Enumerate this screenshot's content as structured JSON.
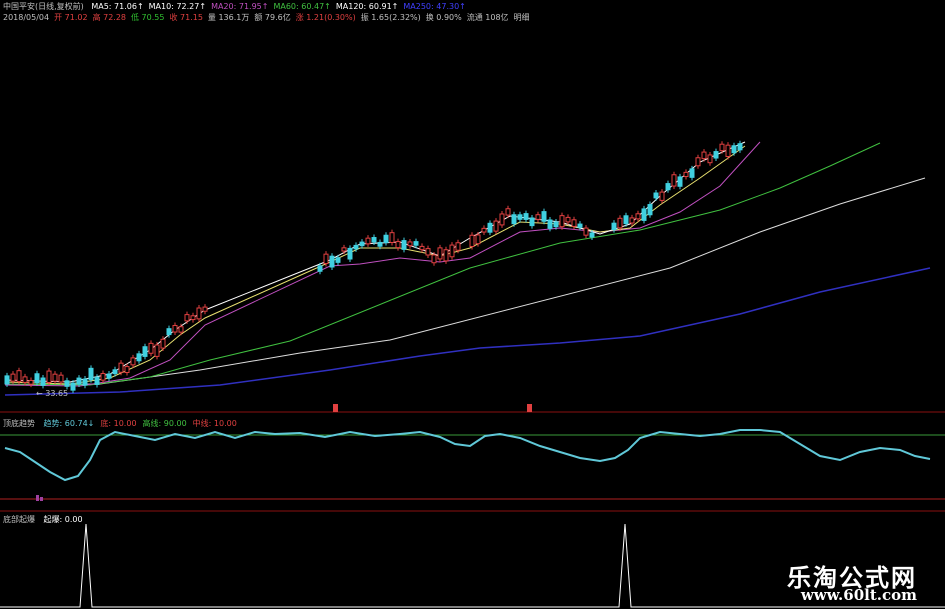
{
  "main_panel": {
    "title": "中国平安(日线,复权前)",
    "ma_labels": [
      {
        "text": "MA5: 71.06↑",
        "color": "#ffffff"
      },
      {
        "text": "MA10: 72.27↑",
        "color": "#ffffff"
      },
      {
        "text": "MA20: 71.95↑",
        "color": "#c050c0"
      },
      {
        "text": "MA60: 60.47↑",
        "color": "#40c040"
      },
      {
        "text": "MA120: 60.91↑",
        "color": "#ffffff"
      },
      {
        "text": "MA250: 47.30↑",
        "color": "#4040ff"
      }
    ],
    "quote_line": [
      {
        "text": "2018/05/04",
        "color": "#c0c0c0"
      },
      {
        "text": "开 71.02",
        "color": "#e04040"
      },
      {
        "text": "高 72.28",
        "color": "#e04040"
      },
      {
        "text": "低 70.55",
        "color": "#30c030"
      },
      {
        "text": "收 71.15",
        "color": "#e04040"
      },
      {
        "text": "量 136.1万",
        "color": "#c0c0c0"
      },
      {
        "text": "额 79.6亿",
        "color": "#c0c0c0"
      },
      {
        "text": "涨 1.21(0.30%)",
        "color": "#e04040"
      },
      {
        "text": "振 1.65(2.32%)",
        "color": "#c0c0c0"
      },
      {
        "text": "换 0.90%",
        "color": "#c0c0c0"
      },
      {
        "text": "流通 108亿",
        "color": "#c0c0c0"
      },
      {
        "text": "明细",
        "color": "#c0c0c0"
      }
    ],
    "low_price_label": "← 33.65",
    "signal_marks": [
      "B",
      "B"
    ]
  },
  "indicator_panel": {
    "title": "顶底趋势",
    "items": [
      {
        "text": "趋势: 60.74↓",
        "color": "#60c8d8"
      },
      {
        "text": "底: 10.00",
        "color": "#e04040"
      },
      {
        "text": "高线: 90.00",
        "color": "#40c040"
      },
      {
        "text": "中线: 10.00",
        "color": "#e04040"
      }
    ]
  },
  "signal_panel": {
    "title": "底部起爆",
    "items": [
      {
        "text": "起爆: 0.00",
        "color": "#ffffff"
      }
    ]
  },
  "watermark": {
    "line1": "乐淘公式网",
    "line2": "www.60lt.com"
  },
  "colors": {
    "background": "#000000",
    "up": "#e04040",
    "down": "#40d0e0",
    "ma5": "#ffffff",
    "ma10": "#e8e070",
    "ma20": "#c050c0",
    "ma60": "#40c040",
    "ma120": "#dddddd",
    "ma250": "#3030c0",
    "trend": "#60c8d8"
  },
  "chart_data": [
    {
      "type": "candlestick",
      "title": "中国平安(日线,复权前)",
      "series": [
        {
          "name": "MA5",
          "values": [
            34,
            36,
            38,
            42,
            48,
            52,
            53,
            55,
            56,
            55,
            57,
            58,
            59,
            62,
            66,
            69,
            71
          ]
        },
        {
          "name": "MA10",
          "values": [
            34,
            35,
            37,
            40,
            45,
            50,
            52,
            54,
            55,
            55,
            56,
            57,
            58,
            61,
            64,
            68,
            72
          ]
        },
        {
          "name": "MA20",
          "values": [
            34,
            35,
            36,
            39,
            43,
            48,
            50,
            52,
            54,
            54,
            55,
            56,
            57,
            60,
            63,
            67,
            72
          ]
        },
        {
          "name": "MA60",
          "values": [
            33,
            34,
            35,
            36,
            38,
            40,
            43,
            46,
            48,
            49,
            51,
            53,
            54,
            56,
            58,
            59,
            60
          ]
        },
        {
          "name": "MA120",
          "values": [
            33,
            33,
            34,
            35,
            36,
            37,
            39,
            41,
            43,
            45,
            47,
            49,
            51,
            54,
            57,
            59,
            61
          ]
        },
        {
          "name": "MA250",
          "values": [
            32,
            32,
            33,
            33,
            34,
            35,
            36,
            37,
            38,
            39,
            40,
            42,
            43,
            44,
            45,
            46,
            47
          ]
        }
      ],
      "annotations": [
        "33.65"
      ]
    },
    {
      "type": "line",
      "title": "顶底趋势",
      "series": [
        {
          "name": "趋势",
          "values": [
            85,
            70,
            40,
            15,
            55,
            85,
            88,
            87,
            90,
            86,
            60,
            80,
            88,
            89,
            89,
            70,
            40,
            60,
            85,
            88,
            75,
            45,
            60,
            85,
            88,
            86,
            88,
            85,
            80,
            70,
            75,
            60
          ]
        }
      ],
      "lines": [
        {
          "name": "高线",
          "value": 90
        },
        {
          "name": "底",
          "value": 10
        }
      ]
    },
    {
      "type": "line",
      "title": "底部起爆",
      "series": [
        {
          "name": "起爆",
          "x": [
            85,
            625
          ],
          "spike": 1
        }
      ]
    }
  ]
}
